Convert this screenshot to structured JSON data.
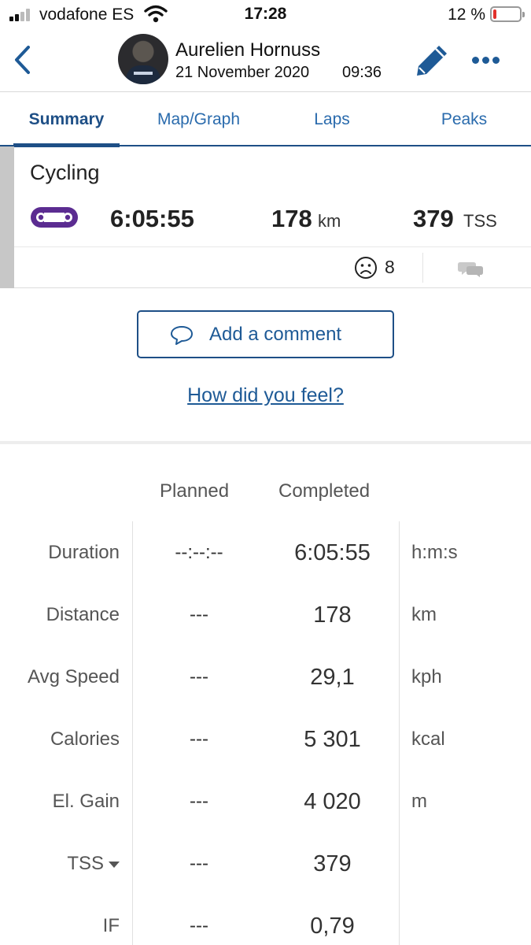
{
  "status_bar": {
    "carrier": "vodafone ES",
    "time": "17:28",
    "battery_percent": "12 %",
    "battery_level": 0.12
  },
  "header": {
    "athlete_name": "Aurelien Hornuss",
    "date": "21 November 2020",
    "time": "09:36"
  },
  "tabs": [
    {
      "label": "Summary",
      "active": true
    },
    {
      "label": "Map/Graph",
      "active": false
    },
    {
      "label": "Laps",
      "active": false
    },
    {
      "label": "Peaks",
      "active": false
    }
  ],
  "summary": {
    "sport": "Cycling",
    "sport_icon": "bike-chain-icon",
    "duration": "6:05:55",
    "distance": "178",
    "distance_unit": "km",
    "tss": "379",
    "tss_unit": "TSS",
    "feeling_icon": "frown-face-icon",
    "feeling_value": "8",
    "comments_icon": "chat-bubbles-icon"
  },
  "actions": {
    "add_comment": "Add a comment",
    "how_did_you_feel": "How did you feel?"
  },
  "stats": {
    "headers": {
      "planned": "Planned",
      "completed": "Completed"
    },
    "rows": [
      {
        "label": "Duration",
        "planned": "--:--:--",
        "completed": "6:05:55",
        "unit": "h:m:s"
      },
      {
        "label": "Distance",
        "planned": "---",
        "completed": "178",
        "unit": "km"
      },
      {
        "label": "Avg Speed",
        "planned": "---",
        "completed": "29,1",
        "unit": "kph"
      },
      {
        "label": "Calories",
        "planned": "---",
        "completed": "5 301",
        "unit": "kcal"
      },
      {
        "label": "El. Gain",
        "planned": "---",
        "completed": "4 020",
        "unit": "m"
      },
      {
        "label": "TSS",
        "planned": "---",
        "completed": "379",
        "unit": ""
      },
      {
        "label": "IF",
        "planned": "---",
        "completed": "0,79",
        "unit": ""
      }
    ]
  },
  "colors": {
    "accent": "#1e4f86",
    "link": "#1e5a96",
    "sport_purple": "#5b2c91",
    "battery_low": "#e2302b"
  }
}
